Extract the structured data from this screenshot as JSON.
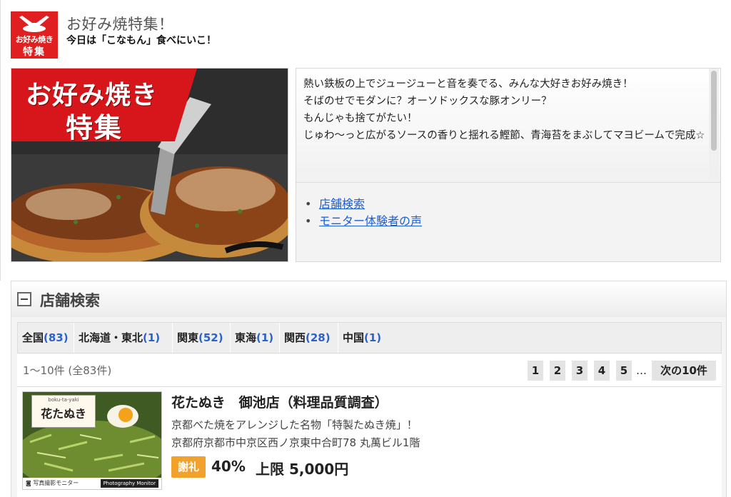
{
  "header": {
    "logo_line1": "お好み焼き",
    "logo_line2": "特集",
    "title": "お好み焼特集！",
    "subtitle": "今日は「こなもん」食べにいこ！"
  },
  "hero": {
    "line1": "お好み焼き",
    "line2": "特集"
  },
  "intro": {
    "paragraphs": [
      "熱い鉄板の上でジュージューと音を奏でる、みんな大好きお好み焼き！",
      "そばのせでモダンに？オーソドックスな豚オンリー？",
      "もんじゃも捨てがたい！",
      "じゅわ〜っと広がるソースの香りと揺れる鰹節、青海苔をまぶしてマヨビームで完成☆"
    ],
    "links": [
      "店舗検索",
      "モニター体験者の声"
    ]
  },
  "search": {
    "title": "店舗検索",
    "regions": [
      {
        "name": "全国",
        "count": "(83)"
      },
      {
        "name": "北海道・東北",
        "count": "(1)"
      },
      {
        "name": "関東",
        "count": "(52)"
      },
      {
        "name": "東海",
        "count": "(1)"
      },
      {
        "name": "関西",
        "count": "(28)"
      },
      {
        "name": "中国",
        "count": "(1)"
      }
    ],
    "result_count": "1〜10件 (全83件)",
    "pages": [
      "1",
      "2",
      "3",
      "4",
      "5"
    ],
    "ellipsis": "…",
    "next_label": "次の10件"
  },
  "items": [
    {
      "thumb_small": "boku-ta-yaki",
      "thumb_sign": "花たぬき",
      "thumb_footer": "写真撮影モニター",
      "thumb_footer_right": "Photography Monitor",
      "title": "花たぬき　御池店（料理品質調査）",
      "desc": "京都べた焼をアレンジした名物「特製たぬき焼」！",
      "address": "京都府京都市中京区西ノ京東中合町78 丸萬ビル1階",
      "reward_badge": "謝礼",
      "reward_pct": "40%",
      "reward_limit": "上限 5,000円"
    }
  ]
}
